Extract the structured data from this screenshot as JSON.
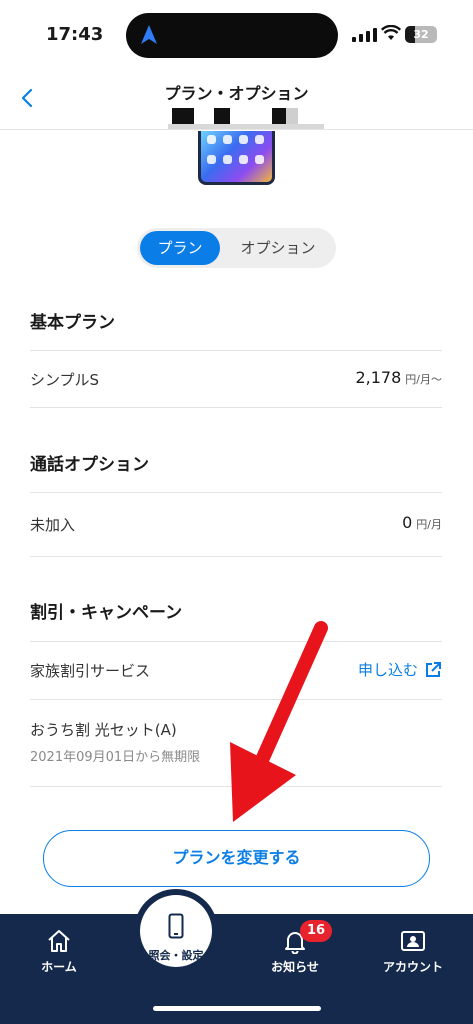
{
  "status": {
    "time": "17:43",
    "battery": "32",
    "battery_level": 0.32
  },
  "header": {
    "title": "プラン・オプション"
  },
  "tabs": {
    "plan": "プラン",
    "option": "オプション",
    "active": "plan"
  },
  "basic_plan": {
    "title": "基本プラン",
    "name": "シンプルS",
    "price": "2,178",
    "unit": "円/月〜"
  },
  "call_option": {
    "title": "通話オプション",
    "name": "未加入",
    "price": "0",
    "unit": "円/月"
  },
  "discounts": {
    "title": "割引・キャンペーン",
    "family_name": "家族割引サービス",
    "family_action": "申し込む",
    "ouchi_name": "おうち割 光セット(A)",
    "ouchi_period": "2021年09月01日から無期限"
  },
  "change_button": "プランを変更する",
  "nav": {
    "home": "ホーム",
    "settings": "照会・設定",
    "notices": "お知らせ",
    "notice_count": "16",
    "account": "アカウント"
  },
  "colors": {
    "accent": "#0a7ee6",
    "nav_bg": "#14294b",
    "badge": "#e8232d",
    "arrow": "#e8141b"
  }
}
